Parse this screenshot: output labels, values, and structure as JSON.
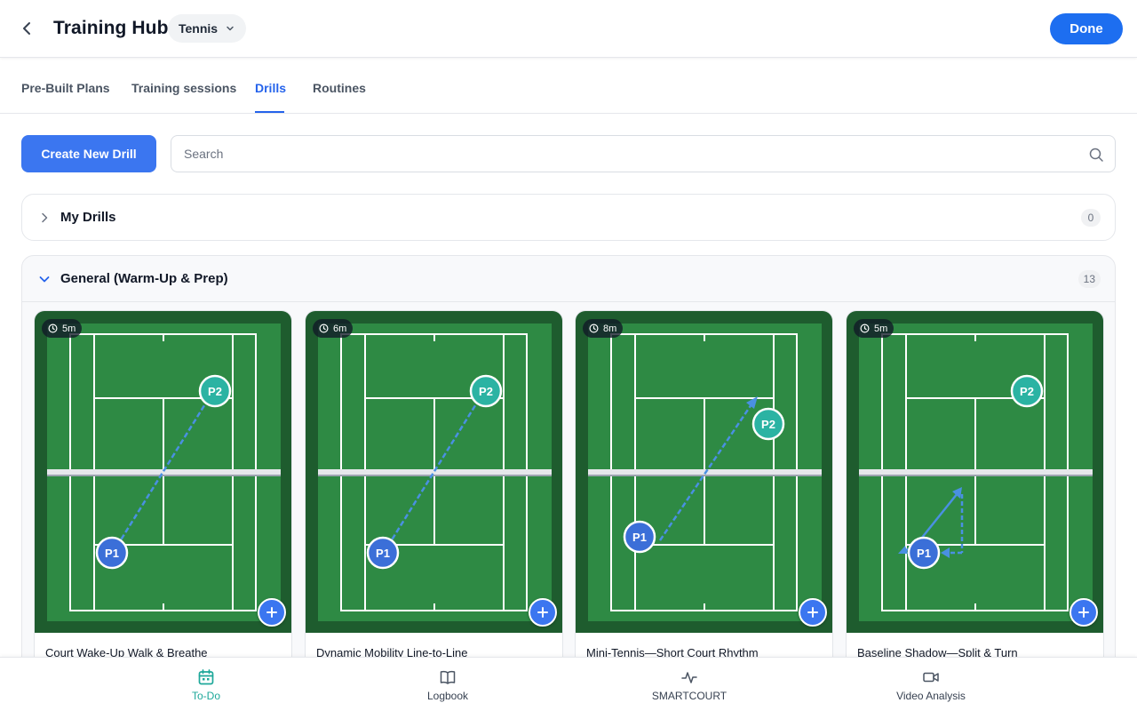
{
  "header": {
    "title": "Training Hub",
    "sport": "Tennis",
    "done_label": "Done"
  },
  "tabs": [
    {
      "label": "Pre-Built Plans",
      "active": false
    },
    {
      "label": "Training sessions",
      "active": false
    },
    {
      "label": "Drills",
      "active": true
    },
    {
      "label": "Routines",
      "active": false
    }
  ],
  "toolbar": {
    "create_label": "Create New Drill",
    "search_placeholder": "Search",
    "search_value": ""
  },
  "sections": {
    "my_drills": {
      "title": "My Drills",
      "count": "0",
      "expanded": false
    },
    "general": {
      "title": "General (Warm-Up & Prep)",
      "count": "13",
      "expanded": true
    }
  },
  "drills": [
    {
      "name": "Court Wake-Up Walk & Breathe",
      "duration": "5m",
      "p1_label": "P1",
      "p2_label": "P2"
    },
    {
      "name": "Dynamic Mobility Line-to-Line",
      "duration": "6m",
      "p1_label": "P1",
      "p2_label": "P2"
    },
    {
      "name": "Mini-Tennis—Short Court Rhythm",
      "duration": "8m",
      "p1_label": "P1",
      "p2_label": "P2"
    },
    {
      "name": "Baseline Shadow—Split & Turn",
      "duration": "5m",
      "p1_label": "P1",
      "p2_label": "P2"
    }
  ],
  "bottom_nav": [
    {
      "label": "To-Do",
      "icon": "calendar-icon",
      "active": true
    },
    {
      "label": "Logbook",
      "icon": "book-icon",
      "active": false
    },
    {
      "label": "SMARTCOURT",
      "icon": "activity-icon",
      "active": false
    },
    {
      "label": "Video Analysis",
      "icon": "video-icon",
      "active": false
    }
  ],
  "colors": {
    "primary": "#1d6ef0",
    "accent_teal": "#1ea89a",
    "court_outer": "#1e5c2e",
    "court_inner": "#2e8a44",
    "player1": "#3b6fd8",
    "player2": "#2bb3a3"
  }
}
